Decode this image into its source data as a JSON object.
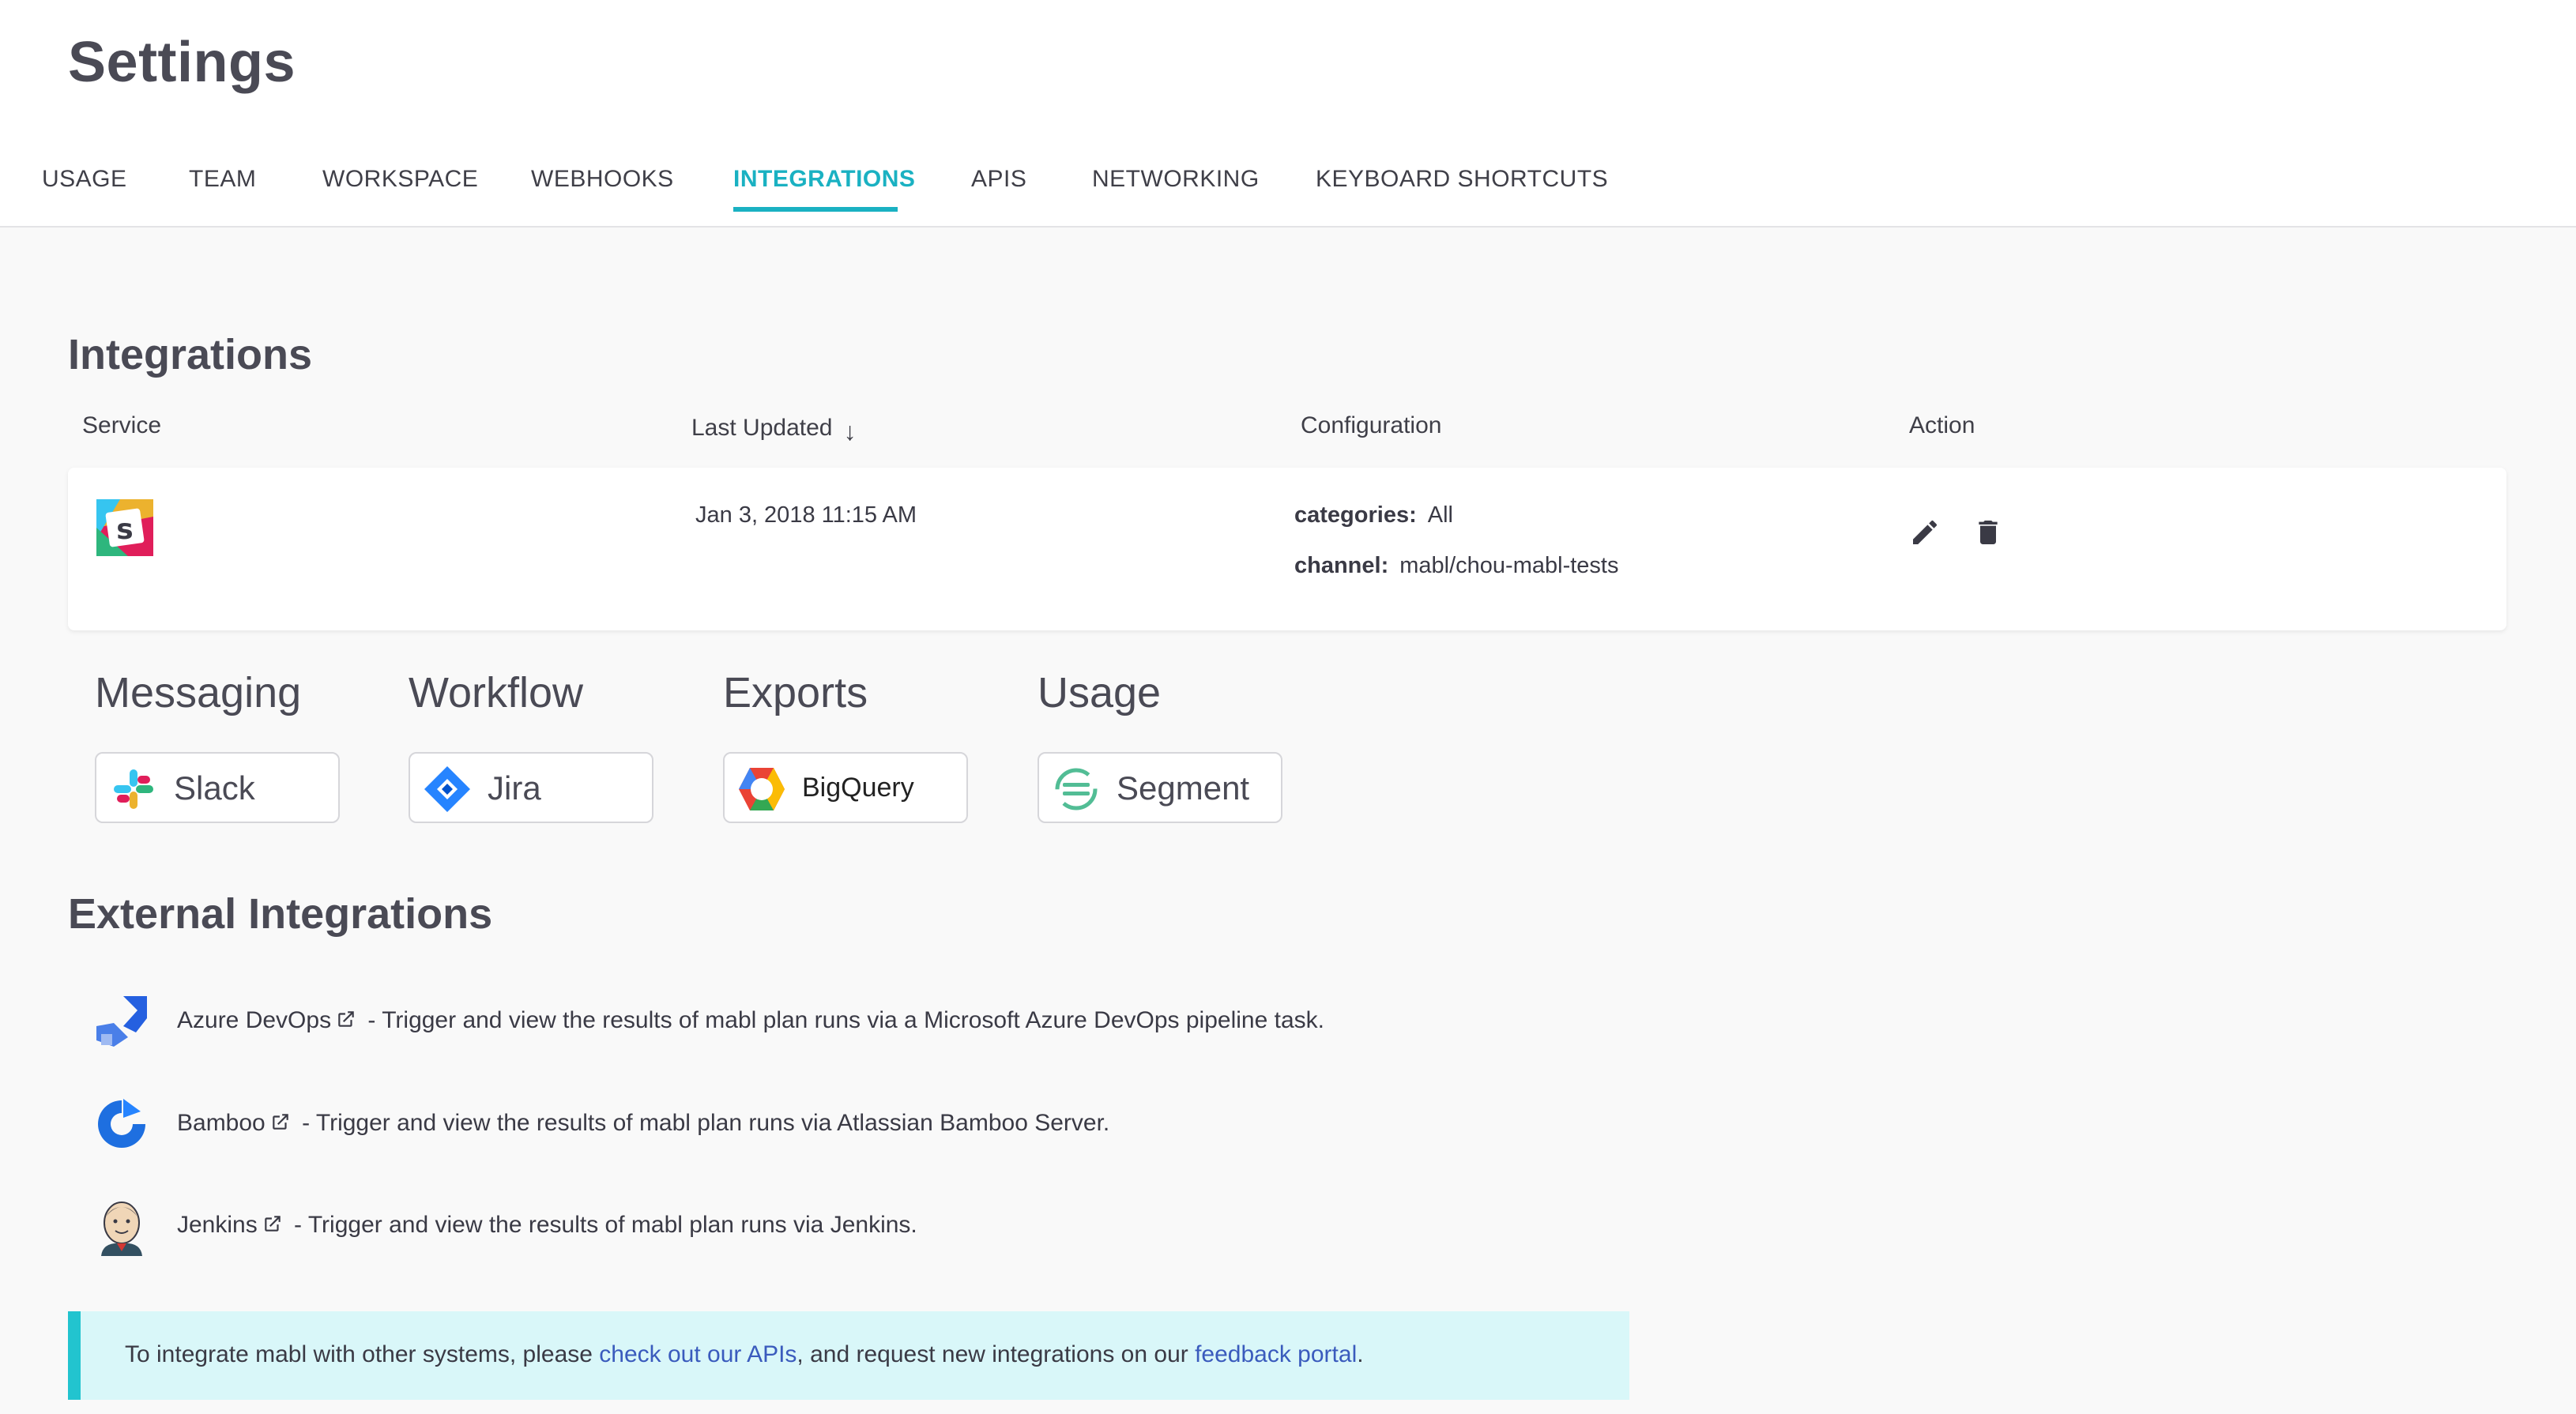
{
  "page": {
    "title": "Settings"
  },
  "tabs": [
    {
      "label": "USAGE"
    },
    {
      "label": "TEAM"
    },
    {
      "label": "WORKSPACE"
    },
    {
      "label": "WEBHOOKS"
    },
    {
      "label": "INTEGRATIONS",
      "active": true
    },
    {
      "label": "APIS"
    },
    {
      "label": "NETWORKING"
    },
    {
      "label": "KEYBOARD SHORTCUTS"
    }
  ],
  "integrations": {
    "title": "Integrations",
    "columns": {
      "service": "Service",
      "last_updated": "Last Updated",
      "sort_indicator": "↓",
      "configuration": "Configuration",
      "action": "Action"
    },
    "rows": [
      {
        "service_icon": "slack-legacy-logo",
        "last_updated": "Jan 3, 2018 11:15 AM",
        "config": [
          {
            "key": "categories:",
            "value": "All"
          },
          {
            "key": "channel:",
            "value": "mabl/chou-mabl-tests"
          }
        ],
        "actions": [
          "edit-icon",
          "trash-icon"
        ]
      }
    ]
  },
  "categories": [
    {
      "title": "Messaging",
      "button": {
        "label": "Slack",
        "icon": "slack-icon"
      }
    },
    {
      "title": "Workflow",
      "button": {
        "label": "Jira",
        "icon": "jira-icon"
      }
    },
    {
      "title": "Exports",
      "button": {
        "label": "BigQuery",
        "icon": "bigquery-icon"
      }
    },
    {
      "title": "Usage",
      "button": {
        "label": "Segment",
        "icon": "segment-icon"
      }
    }
  ],
  "external": {
    "title": "External Integrations",
    "items": [
      {
        "name": "Azure DevOps",
        "icon": "azure-devops-icon",
        "description": " - Trigger and view the results of mabl plan runs via a Microsoft Azure DevOps pipeline task."
      },
      {
        "name": "Bamboo",
        "icon": "bamboo-icon",
        "description": " - Trigger and view the results of mabl plan runs via Atlassian Bamboo Server."
      },
      {
        "name": "Jenkins",
        "icon": "jenkins-icon",
        "description": " - Trigger and view the results of mabl plan runs via Jenkins."
      }
    ]
  },
  "banner": {
    "prefix": "To integrate mabl with other systems, please ",
    "link1": "check out our APIs",
    "middle": ", and request new integrations on our ",
    "link2": "feedback portal",
    "suffix": "."
  },
  "colors": {
    "accent": "#1ab1c2",
    "banner_bg": "#d9f7f9",
    "banner_bar": "#22c4cf",
    "link": "#3a5bbd"
  }
}
